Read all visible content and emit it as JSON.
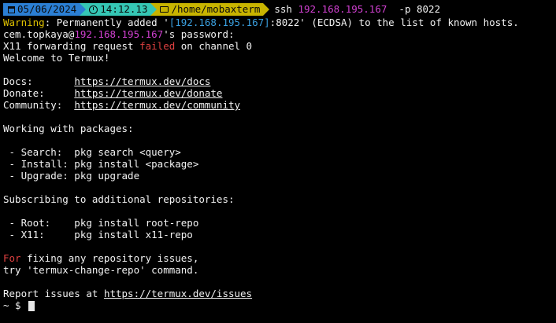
{
  "prompt": {
    "date": "05/06/2024",
    "time": "14:12.13",
    "path": "/home/mobaxterm",
    "command_prefix": "ssh ",
    "command_host": "192.168.195.167",
    "command_suffix": "  -p 8022"
  },
  "output": {
    "warning_label": "Warning",
    "warning_text_1": ": Permanently added '",
    "warning_host": "[192.168.195.167]",
    "warning_text_2": ":8022' (ECDSA) to the list of known hosts.",
    "password_user": "cem.topkaya@",
    "password_host": "192.168.195.167",
    "password_text": "'s password:",
    "x11_text_1": "X11 forwarding request ",
    "x11_failed": "failed",
    "x11_text_2": " on channel 0",
    "welcome": "Welcome to Termux!",
    "docs_label": "Docs:       ",
    "docs_url": "https://termux.dev/docs",
    "donate_label": "Donate:     ",
    "donate_url": "https://termux.dev/donate",
    "community_label": "Community:  ",
    "community_url": "https://termux.dev/community",
    "packages_heading": "Working with packages:",
    "search_line": " - Search:  pkg search <query>",
    "install_line": " - Install: pkg install <package>",
    "upgrade_line": " - Upgrade: pkg upgrade",
    "repos_heading": "Subscribing to additional repositories:",
    "root_line": " - Root:    pkg install root-repo",
    "x11_line": " - X11:     pkg install x11-repo",
    "fix_for": "For",
    "fix_text": " fixing any repository issues,",
    "fix_try": "try 'termux-change-repo' command.",
    "report_text": "Report issues at ",
    "report_url": "https://termux.dev/issues",
    "shell_prompt": "~ $ "
  },
  "colors": {
    "background": "#000000",
    "foreground": "#f2f2f2",
    "date_segment": "#2b7fd4",
    "time_segment": "#35c7b5",
    "path_segment": "#c8b400",
    "warning": "#e0c200",
    "ip_cyan": "#3aa0e0",
    "ip_magenta": "#d040d0",
    "error_red": "#e04040"
  }
}
